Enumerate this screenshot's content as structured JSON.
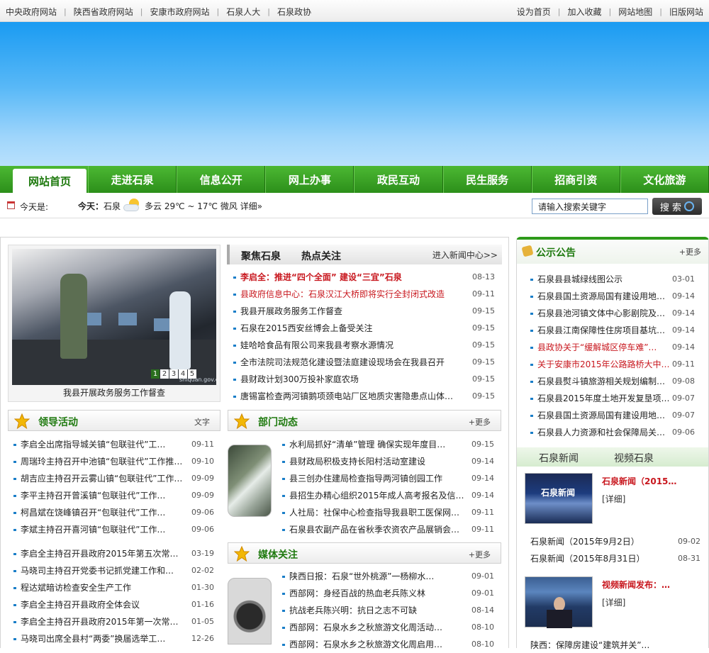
{
  "topbar": {
    "left_links": [
      "中央政府网站",
      "陕西省政府网站",
      "安康市政府网站",
      "石泉人大",
      "石泉政协"
    ],
    "right_links": [
      "设为首页",
      "加入收藏",
      "网站地图",
      "旧版网站"
    ]
  },
  "nav": {
    "items": [
      "网站首页",
      "走进石泉",
      "信息公开",
      "网上办事",
      "政民互动",
      "民生服务",
      "招商引资",
      "文化旅游"
    ]
  },
  "infobar": {
    "today_label": "今天是:",
    "weather_prefix": "今天：",
    "weather_city": "石泉",
    "weather_text": "多云 29℃ ~ 17℃ 微风",
    "weather_detail": "详细»",
    "search_placeholder": "请输入搜索关键字",
    "search_button": "搜 索"
  },
  "photo": {
    "caption": "我县开展政务服务工作督查",
    "pager": [
      "1",
      "2",
      "3",
      "4",
      "5"
    ],
    "watermark": "shiquan.gov.cn"
  },
  "focus": {
    "tab1": "聚焦石泉",
    "tab2": "热点关注",
    "more": "进入新闻中心>>",
    "items": [
      {
        "title": "李启全：推进“四个全面” 建设“三宜”石泉",
        "date": "08-13",
        "red": true,
        "bold": true
      },
      {
        "title": "县政府信息中心：石泉汉江大桥即将实行全封闭式改造",
        "date": "09-11",
        "red": true,
        "bold": false
      },
      {
        "title": "我县开展政务服务工作督查",
        "date": "09-15",
        "red": false,
        "bold": false
      },
      {
        "title": "石泉在2015西安丝博会上备受关注",
        "date": "09-15",
        "red": false,
        "bold": false
      },
      {
        "title": "娃哈哈食品有限公司来我县考察水源情况",
        "date": "09-15",
        "red": false,
        "bold": false
      },
      {
        "title": "全市法院司法规范化建设暨法庭建设现场会在我县召开",
        "date": "09-15",
        "red": false,
        "bold": false
      },
      {
        "title": "县财政计划300万投补家庭农场",
        "date": "09-15",
        "red": false,
        "bold": false
      },
      {
        "title": "唐锡富检查两河镇鹅项颈电站厂区地质灾害隐患点山体…",
        "date": "09-15",
        "red": false,
        "bold": false
      }
    ]
  },
  "leaders": {
    "title": "领导活动",
    "more": "文字",
    "items": [
      {
        "title": "李启全出席指导城关镇“包联驻代”工…",
        "date": "09-11"
      },
      {
        "title": "周瑞玲主持召开中池镇“包联驻代”工作推…",
        "date": "09-10"
      },
      {
        "title": "胡吉应主持召开云雾山镇“包联驻代”工作…",
        "date": "09-09"
      },
      {
        "title": "李平主持召开曾溪镇“包联驻代”工作…",
        "date": "09-09"
      },
      {
        "title": "柯昌斌在饶峰镇召开“包联驻代”工作…",
        "date": "09-06"
      },
      {
        "title": "李斌主持召开喜河镇“包联驻代”工作…",
        "date": "09-06"
      }
    ],
    "items2": [
      {
        "title": "李启全主持召开县政府2015年第五次常…",
        "date": "03-19"
      },
      {
        "title": "马晓司主持召开党委书记抓党建工作和…",
        "date": "02-02"
      },
      {
        "title": "程达斌暗访检查安全生产工作",
        "date": "01-30"
      },
      {
        "title": "李启全主持召开县政府全体会议",
        "date": "01-16"
      },
      {
        "title": "李启全主持召开县政府2015年第一次常…",
        "date": "01-05"
      },
      {
        "title": "马晓司出席全县村“两委”换届选举工…",
        "date": "12-26"
      }
    ]
  },
  "dept": {
    "title": "部门动态",
    "more": "+更多",
    "items": [
      {
        "title": "水利局抓好“清单”管理 确保实现年度目…",
        "date": "09-15"
      },
      {
        "title": "县财政局积极支持长阳村活动室建设",
        "date": "09-14"
      },
      {
        "title": "县三创办住建局检查指导两河镇创园工作",
        "date": "09-14"
      },
      {
        "title": "县招生办精心组织2015年成人高考报名及信…",
        "date": "09-14"
      },
      {
        "title": "人社局：社保中心检查指导我县职工医保网…",
        "date": "09-11"
      },
      {
        "title": "石泉县农副产品在省秋季农资农产品展销会…",
        "date": "09-11"
      }
    ]
  },
  "media": {
    "title": "媒体关注",
    "more": "+更多",
    "items": [
      {
        "title": "陕西日报：石泉“世外桃源”一杨柳水…",
        "date": "09-01"
      },
      {
        "title": "西部网：身经百战的热血老兵陈义林",
        "date": "09-01"
      },
      {
        "title": "抗战老兵陈兴明：抗日之志不可缺",
        "date": "08-14"
      },
      {
        "title": "西部网：石泉水乡之秋旅游文化周活动…",
        "date": "08-10"
      },
      {
        "title": "西部网：石泉水乡之秋旅游文化周启用…",
        "date": "08-10"
      }
    ]
  },
  "notice": {
    "title": "公示公告",
    "more": "+更多",
    "items": [
      {
        "title": "石泉县县城绿线图公示",
        "date": "03-01",
        "red": false
      },
      {
        "title": "石泉县国土资源局国有建设用地…",
        "date": "09-14",
        "red": false
      },
      {
        "title": "石泉县池河镇文体中心影剧院及…",
        "date": "09-14",
        "red": false
      },
      {
        "title": "石泉县江南保障性住房项目基坑…",
        "date": "09-14",
        "red": false
      },
      {
        "title": "县政协关于“缓解城区停车难”…",
        "date": "09-14",
        "red": true
      },
      {
        "title": "关于安康市2015年公路路桥大中…",
        "date": "09-11",
        "red": true
      },
      {
        "title": "石泉县熨斗镇旅游相关规划编制…",
        "date": "09-08",
        "red": false
      },
      {
        "title": "石泉县2015年度土地开发复垦项…",
        "date": "09-07",
        "red": false
      },
      {
        "title": "石泉县国土资源局国有建设用地…",
        "date": "09-07",
        "red": false
      },
      {
        "title": "石泉县人力资源和社会保障局关…",
        "date": "09-06",
        "red": false
      }
    ]
  },
  "news": {
    "tab1": "石泉新闻",
    "tab2": "视频石泉",
    "card1_title": "石泉新闻（2015…",
    "card1_detail": "[详细]",
    "card1_img_text": "石泉新闻",
    "items": [
      {
        "title": "石泉新闻（2015年9月2日）",
        "date": "09-02"
      },
      {
        "title": "石泉新闻（2015年8月31日）",
        "date": "08-31"
      }
    ],
    "card2_title": "视频新闻发布：…",
    "card2_detail": "[详细]",
    "tail_item": "陕西：保障房建设“建筑并关”…"
  },
  "colors": {
    "nav_green": "#2c8f1a",
    "title_green": "#1f7a0f",
    "highlight_red": "#c8171e",
    "banner_blue": "#1a9bf2"
  }
}
